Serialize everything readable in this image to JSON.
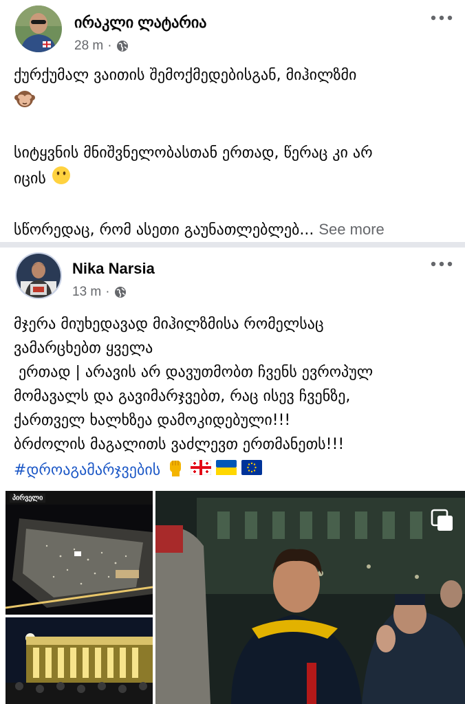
{
  "post1": {
    "author": "ირაკლი ლატარია",
    "time": "28 m",
    "separator": "·",
    "privacy_icon": "globe-icon",
    "menu_icon": "more-dots-icon",
    "lines": [
      "ქურქუმალ ვაითის შემოქმედებისგან, მიჰილზმი",
      "",
      "სიტყვნის მნიშვნელობასთან ერთად, წერაც კი არ",
      "იცის",
      "",
      "სწორედაც, რომ ასეთი გაუნათლებლებ..."
    ],
    "emoji_1": "see-no-evil-monkey-icon",
    "emoji_2": "no-mouth-face-icon",
    "see_more": "See more"
  },
  "post2": {
    "author": "Nika Narsia",
    "time": "13 m",
    "separator": "·",
    "privacy_icon": "globe-icon",
    "menu_icon": "more-dots-icon",
    "lines": [
      "მჯერა მიუხედავად მიჰილზმისა რომელსაც",
      "ვამარცხებთ ყველა",
      " ერთად | არავის არ დავუთმობთ ჩვენს ევროპულ",
      "მომავალს და გავიმარჯვებთ, რაც ისევ ჩვენზე,",
      "ქართველ ხალხზეა დამოკიდებული!!!",
      "ბრძოლის მაგალითს ვაძლევთ ერთმანეთს!!!"
    ],
    "hashtag": "#დროაგამარჯვების",
    "hashtag_emojis": [
      "raised-fist-icon",
      "georgia-flag-icon",
      "ukraine-flag-icon",
      "eu-flag-icon"
    ],
    "media": {
      "tv_logo": "პირველი",
      "multi_photo_icon": "gallery-icon"
    }
  },
  "colors": {
    "text": "#050505",
    "meta": "#65676b",
    "hashtag": "#1b57c6",
    "divider": "#e4e6eb"
  }
}
